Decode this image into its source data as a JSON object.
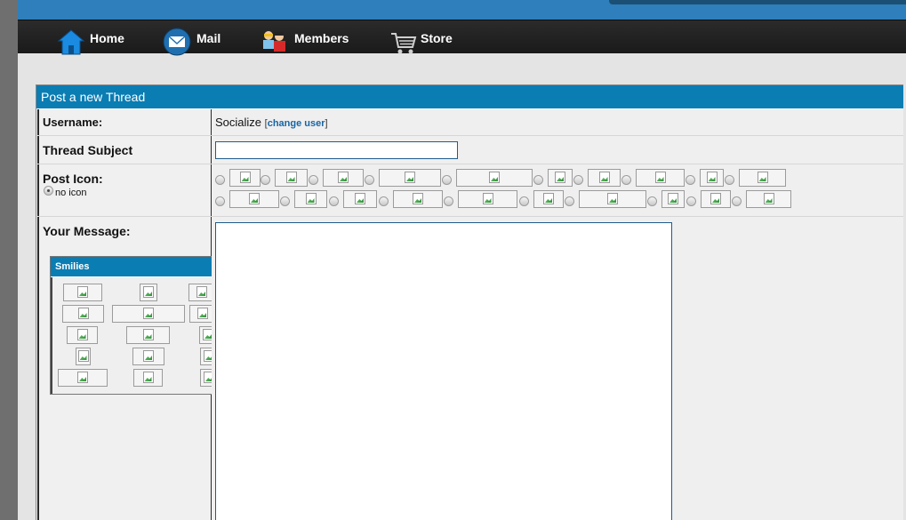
{
  "nav": {
    "items": [
      {
        "label": "Home",
        "icon": "home-icon"
      },
      {
        "label": "Mail",
        "icon": "mail-icon"
      },
      {
        "label": "Members",
        "icon": "members-icon"
      },
      {
        "label": "Store",
        "icon": "cart-icon"
      }
    ]
  },
  "form": {
    "title": "Post a new Thread",
    "username_label": "Username:",
    "username_value": "Socialize",
    "change_user_open": "[",
    "change_user_link": "change user",
    "change_user_close": "]",
    "subject_label": "Thread Subject",
    "subject_value": "",
    "post_icon_label": "Post Icon:",
    "no_icon_label": "no icon",
    "message_label": "Your Message:",
    "message_value": ""
  },
  "smilies": {
    "title": "Smilies"
  },
  "colors": {
    "accent": "#0a7db3",
    "topbar": "#2e7fbb",
    "navbar": "#1f1f1f"
  }
}
